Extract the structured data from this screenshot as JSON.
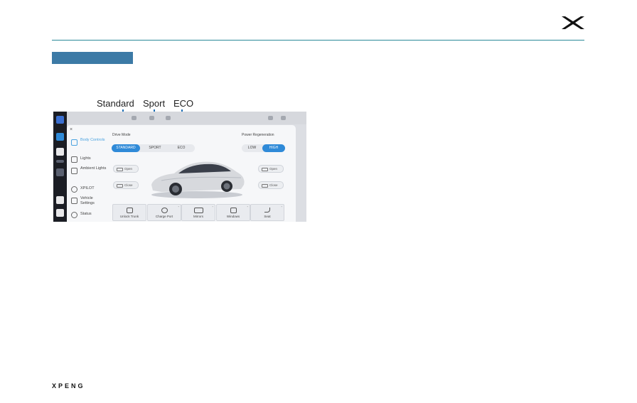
{
  "brand": {
    "footer_wordmark": "XPENG"
  },
  "callouts": [
    "Standard",
    "Sport",
    "ECO"
  ],
  "screen": {
    "menu": [
      {
        "label": "Body Controls",
        "active": true
      },
      {
        "label": "Lights",
        "active": false
      },
      {
        "label": "Ambient Lights",
        "active": false
      },
      {
        "label": "XPILOT",
        "active": false
      },
      {
        "label": "Vehicle Settings",
        "active": false
      },
      {
        "label": "Status",
        "active": false
      }
    ],
    "drive_mode": {
      "title": "Drive Mode",
      "options": [
        "STANDARD",
        "SPORT",
        "ECO"
      ],
      "selected": "STANDARD"
    },
    "power_regen": {
      "title": "Power Regeneration",
      "options": [
        "LOW",
        "HIGH"
      ],
      "selected": "HIGH"
    },
    "doors": {
      "left_open": "Open",
      "left_close": "Close",
      "right_open": "Open",
      "right_close": "Close"
    },
    "quick_buttons": [
      "Unlock Trunk",
      "Charge Port",
      "Mirrors",
      "Windows",
      "Seat"
    ],
    "close_symbol": "×"
  },
  "colors": {
    "accent": "#2f8ad8",
    "rule": "#2b8a99",
    "section_bar": "#3c7aa6",
    "arrow": "#1e6fb6"
  }
}
